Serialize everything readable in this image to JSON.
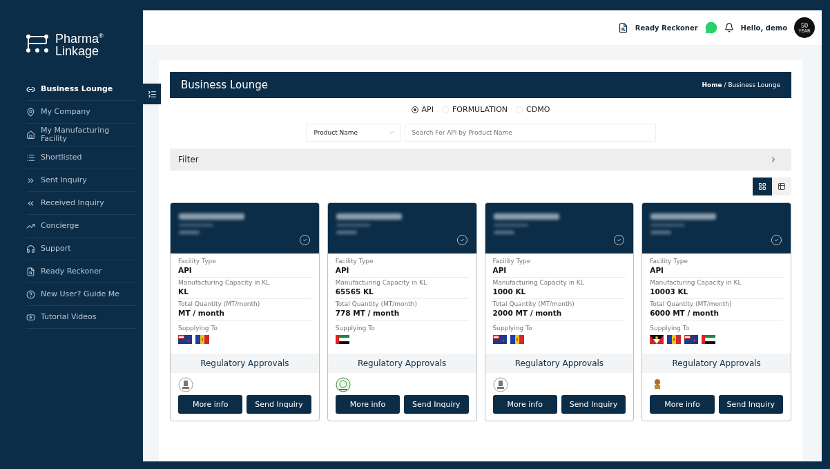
{
  "brand": {
    "line_1": "Pharma",
    "mark": "®",
    "line_2": "Linkage"
  },
  "sidebar": {
    "items": [
      {
        "label": "Business Lounge",
        "selected": true
      },
      {
        "label": "My Company",
        "selected": false
      },
      {
        "label": "My Manufacturing Facility",
        "selected": false
      },
      {
        "label": "Shortlisted",
        "selected": false
      },
      {
        "label": "Sent Inquiry",
        "selected": false
      },
      {
        "label": "Received Inquiry",
        "selected": false
      },
      {
        "label": "Concierge",
        "selected": false
      },
      {
        "label": "Support",
        "selected": false
      },
      {
        "label": "Ready Reckoner",
        "selected": false
      },
      {
        "label": "New User? Guide Me",
        "selected": false
      },
      {
        "label": "Tutorial Videos",
        "selected": false
      }
    ]
  },
  "header": {
    "ready_reckoner": "Ready Reckoner",
    "greeting": "Hello, demo",
    "badge_number": "50",
    "badge_text": "YEAR"
  },
  "page": {
    "title": "Business Lounge",
    "breadcrumb": [
      "Home",
      "/",
      "Business Lounge"
    ]
  },
  "types": [
    {
      "label": "API",
      "selected": true
    },
    {
      "label": "FORMULATION",
      "selected": false
    },
    {
      "label": "CDMO",
      "selected": false
    }
  ],
  "search": {
    "select": "Product Name",
    "placeholder": "Search For API by Product Name"
  },
  "filter": {
    "label": "Filter",
    "expanded": false
  },
  "view": [
    {
      "kind": "cards",
      "selected": true
    },
    {
      "kind": "table",
      "selected": false
    }
  ],
  "cards": [
    {
      "verified": true,
      "fields": [
        {
          "label": "Facility Type",
          "value": "API"
        },
        {
          "label": "Manufacturing Capacity in KL",
          "value": "KL"
        },
        {
          "label": "Total Quantity (MT/month)",
          "value": "MT / month"
        }
      ],
      "supplying_label": "Supplying To",
      "flags": [
        {
          "kind": "nz"
        },
        {
          "kind": "md"
        }
      ],
      "approvals_label": "Regulatory Approvals",
      "approvals": [
        {
          "kind": "india"
        }
      ],
      "buttons": [
        "More info",
        "Send Inquiry"
      ]
    },
    {
      "verified": true,
      "fields": [
        {
          "label": "Facility Type",
          "value": "API"
        },
        {
          "label": "Manufacturing Capacity in KL",
          "value": "65565 KL"
        },
        {
          "label": "Total Quantity (MT/month)",
          "value": "778 MT / month"
        }
      ],
      "supplying_label": "Supplying To",
      "flags": [
        {
          "kind": "ae"
        }
      ],
      "approvals_label": "Regulatory Approvals",
      "approvals": [
        {
          "kind": "pakistan"
        }
      ],
      "buttons": [
        "More info",
        "Send Inquiry"
      ]
    },
    {
      "verified": true,
      "fields": [
        {
          "label": "Facility Type",
          "value": "API"
        },
        {
          "label": "Manufacturing Capacity in KL",
          "value": "1000 KL"
        },
        {
          "label": "Total Quantity (MT/month)",
          "value": "2000 MT / month"
        }
      ],
      "supplying_label": "Supplying To",
      "flags": [
        {
          "kind": "nz"
        },
        {
          "kind": "md"
        }
      ],
      "approvals_label": "Regulatory Approvals",
      "approvals": [
        {
          "kind": "india"
        }
      ],
      "buttons": [
        "More info",
        "Send Inquiry"
      ]
    },
    {
      "verified": true,
      "fields": [
        {
          "label": "Facility Type",
          "value": "API"
        },
        {
          "label": "Manufacturing Capacity in KL",
          "value": "10003 KL"
        },
        {
          "label": "Total Quantity (MT/month)",
          "value": "6000 MT / month"
        }
      ],
      "supplying_label": "Supplying To",
      "flags": [
        {
          "kind": "ag"
        },
        {
          "kind": "md"
        },
        {
          "kind": "nz"
        },
        {
          "kind": "ae"
        }
      ],
      "approvals_label": "Regulatory Approvals",
      "approvals": [
        {
          "kind": "uae"
        }
      ],
      "buttons": [
        "More info",
        "Send Inquiry"
      ]
    }
  ]
}
